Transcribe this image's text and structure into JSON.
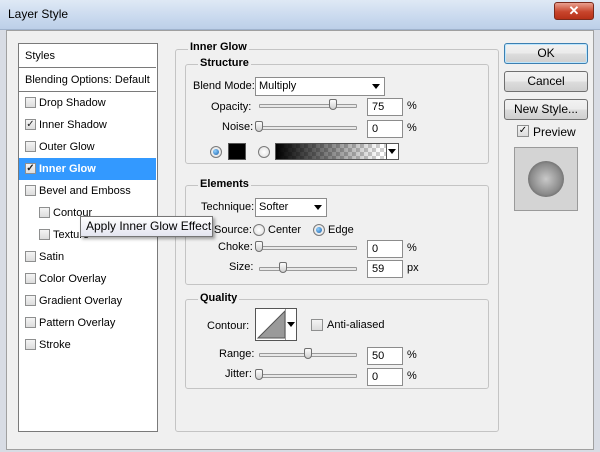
{
  "window": {
    "title": "Layer Style",
    "close_glyph": "✕"
  },
  "styles_list": {
    "header": "Styles",
    "blending_options": "Blending Options: Default",
    "items": [
      {
        "label": "Drop Shadow",
        "checked": false,
        "selected": false,
        "indent": false
      },
      {
        "label": "Inner Shadow",
        "checked": true,
        "selected": false,
        "indent": false
      },
      {
        "label": "Outer Glow",
        "checked": false,
        "selected": false,
        "indent": false
      },
      {
        "label": "Inner Glow",
        "checked": true,
        "selected": true,
        "indent": false
      },
      {
        "label": "Bevel and Emboss",
        "checked": false,
        "selected": false,
        "indent": false
      },
      {
        "label": "Contour",
        "checked": false,
        "selected": false,
        "indent": true
      },
      {
        "label": "Texture",
        "checked": false,
        "selected": false,
        "indent": true
      },
      {
        "label": "Satin",
        "checked": false,
        "selected": false,
        "indent": false
      },
      {
        "label": "Color Overlay",
        "checked": false,
        "selected": false,
        "indent": false
      },
      {
        "label": "Gradient Overlay",
        "checked": false,
        "selected": false,
        "indent": false
      },
      {
        "label": "Pattern Overlay",
        "checked": false,
        "selected": false,
        "indent": false
      },
      {
        "label": "Stroke",
        "checked": false,
        "selected": false,
        "indent": false
      }
    ],
    "check_glyph": "✓"
  },
  "tooltip": "Apply Inner Glow Effect",
  "main": {
    "section_title": "Inner Glow",
    "structure": {
      "label": "Structure",
      "blend_mode_label": "Blend Mode:",
      "blend_mode_value": "Multiply",
      "opacity_label": "Opacity:",
      "opacity_value": "75",
      "opacity_level": 0.75,
      "noise_label": "Noise:",
      "noise_value": "0",
      "noise_level": 0,
      "percent": "%",
      "color_swatch": "#000000"
    },
    "elements": {
      "label": "Elements",
      "technique_label": "Technique:",
      "technique_value": "Softer",
      "source_label": "Source:",
      "source_center": "Center",
      "source_edge": "Edge",
      "choke_label": "Choke:",
      "choke_value": "0",
      "choke_level": 0,
      "size_label": "Size:",
      "size_value": "59",
      "size_level": 0.24,
      "percent": "%",
      "px": "px"
    },
    "quality": {
      "label": "Quality",
      "contour_label": "Contour:",
      "anti_aliased_label": "Anti-aliased",
      "range_label": "Range:",
      "range_value": "50",
      "range_level": 0.5,
      "jitter_label": "Jitter:",
      "jitter_value": "0",
      "jitter_level": 0,
      "percent": "%"
    }
  },
  "buttons": {
    "ok": "OK",
    "cancel": "Cancel",
    "new_style": "New Style...",
    "preview_label": "Preview",
    "preview_checked": true
  },
  "colors": {
    "selection": "#3399ff",
    "accent": "#3c7fb1"
  }
}
